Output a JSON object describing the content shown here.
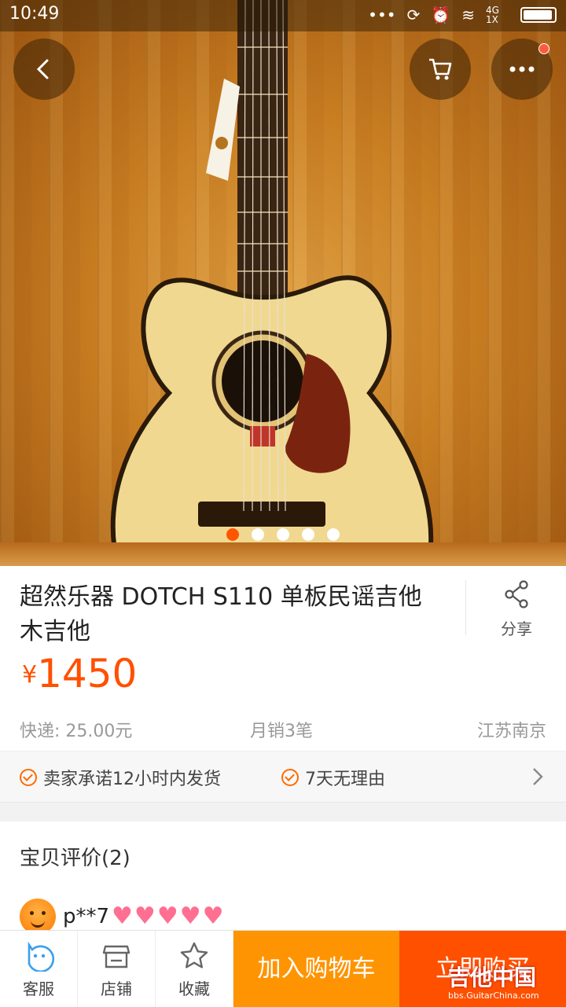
{
  "statusbar": {
    "time": "10:49",
    "network": "4G 1X"
  },
  "product": {
    "title": "超然乐器 DOTCH S110 单板民谣吉他 木吉他",
    "currency": "¥",
    "price": "1450",
    "shipping": "快递: 25.00元",
    "monthly_sales": "月销3笔",
    "location": "江苏南京",
    "image_count": 5,
    "image_active_index": 1
  },
  "share": {
    "label": "分享"
  },
  "promises": [
    "卖家承诺12小时内发货",
    "7天无理由"
  ],
  "review": {
    "heading": "宝贝评价(2)",
    "user": "p**7",
    "heart_count": 5
  },
  "bottom_bar": {
    "service_label": "客服",
    "shop_label": "店铺",
    "favorite_label": "收藏",
    "add_cart_label": "加入购物车",
    "buy_now_label": "立即购买"
  },
  "watermark": {
    "title": "吉他中国",
    "url": "bbs.GuitarChina.com"
  },
  "colors": {
    "accent": "#ff5000",
    "cart_button": "#ff9402",
    "hearts": "#ff6f91"
  }
}
